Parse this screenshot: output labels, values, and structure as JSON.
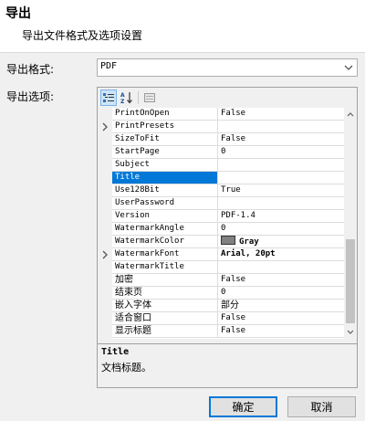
{
  "dialog": {
    "title": "导出",
    "subtitle": "导出文件格式及选项设置"
  },
  "format": {
    "label": "导出格式:",
    "value": "PDF"
  },
  "options": {
    "label": "导出选项:"
  },
  "properties": [
    {
      "name": "PrintOnOpen",
      "value": "False"
    },
    {
      "name": "PrintPresets",
      "value": "",
      "expandable": true
    },
    {
      "name": "SizeToFit",
      "value": "False"
    },
    {
      "name": "StartPage",
      "value": "0"
    },
    {
      "name": "Subject",
      "value": ""
    },
    {
      "name": "Title",
      "value": "",
      "selected": true
    },
    {
      "name": "Use128Bit",
      "value": "True"
    },
    {
      "name": "UserPassword",
      "value": ""
    },
    {
      "name": "Version",
      "value": "PDF-1.4"
    },
    {
      "name": "WatermarkAngle",
      "value": "0"
    },
    {
      "name": "WatermarkColor",
      "value": "Gray",
      "swatch": "#808080"
    },
    {
      "name": "WatermarkFont",
      "value": "Arial, 20pt",
      "expandable": true
    },
    {
      "name": "WatermarkTitle",
      "value": ""
    },
    {
      "name": "加密",
      "value": "False"
    },
    {
      "name": "结束页",
      "value": "0"
    },
    {
      "name": "嵌入字体",
      "value": "部分"
    },
    {
      "name": "适合窗口",
      "value": "False"
    },
    {
      "name": "显示标题",
      "value": "False"
    }
  ],
  "help": {
    "title": "Title",
    "description": "文档标题。"
  },
  "buttons": {
    "ok": "确定",
    "cancel": "取消"
  },
  "colors": {
    "selection": "#0078d7",
    "accent_border": "#0078d7"
  }
}
